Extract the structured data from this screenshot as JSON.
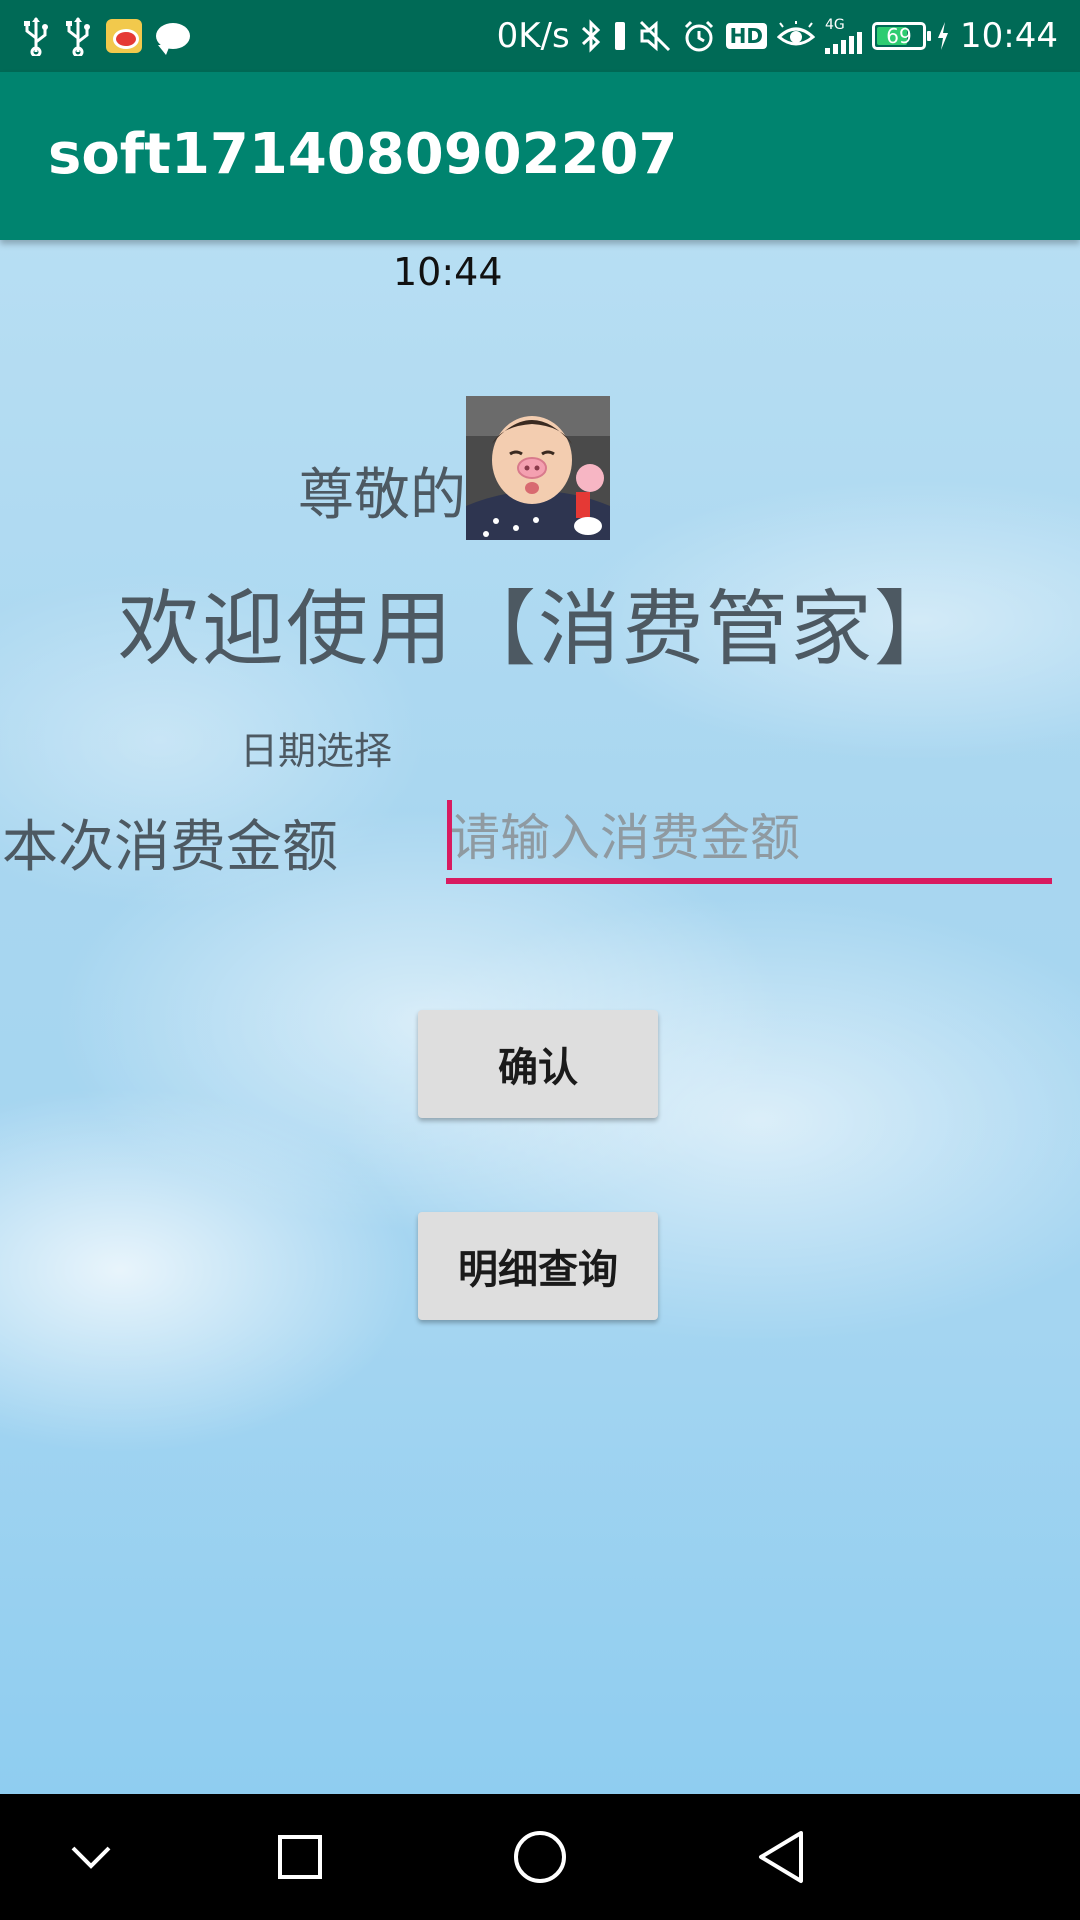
{
  "status_bar": {
    "net_speed": "0K/s",
    "network": "4G",
    "battery_level": "69",
    "battery_fraction": 0.69,
    "time": "10:44",
    "hd_label": "HD",
    "left_icons": [
      "usb-icon",
      "usb-icon",
      "weibo-icon",
      "chat-icon"
    ],
    "right_icons": [
      "bluetooth-icon",
      "vibrate-icon",
      "mute-icon",
      "alarm-icon",
      "hd-icon",
      "eye-comfort-icon",
      "signal-icon",
      "battery-icon",
      "charging-icon"
    ]
  },
  "app_bar": {
    "title": "soft1714080902207"
  },
  "main": {
    "time": "10:44",
    "greeting": "尊敬的",
    "avatar": "avatar-photo",
    "welcome": "欢迎使用【消费管家】",
    "date_picker_label": "日期选择",
    "amount_label": "本次消费金额",
    "amount_input": {
      "value": "",
      "placeholder": "请输入消费金额"
    },
    "confirm_button": "确认",
    "detail_button": "明细查询"
  },
  "colors": {
    "status_bar": "#006a56",
    "app_bar": "#00846f",
    "accent": "#d81b60",
    "text_gray": "#4d5962",
    "button_bg": "#dedede"
  },
  "nav_bar": {
    "icons": [
      "chevron-down-icon",
      "recents-square-icon",
      "home-circle-icon",
      "back-triangle-icon"
    ]
  }
}
